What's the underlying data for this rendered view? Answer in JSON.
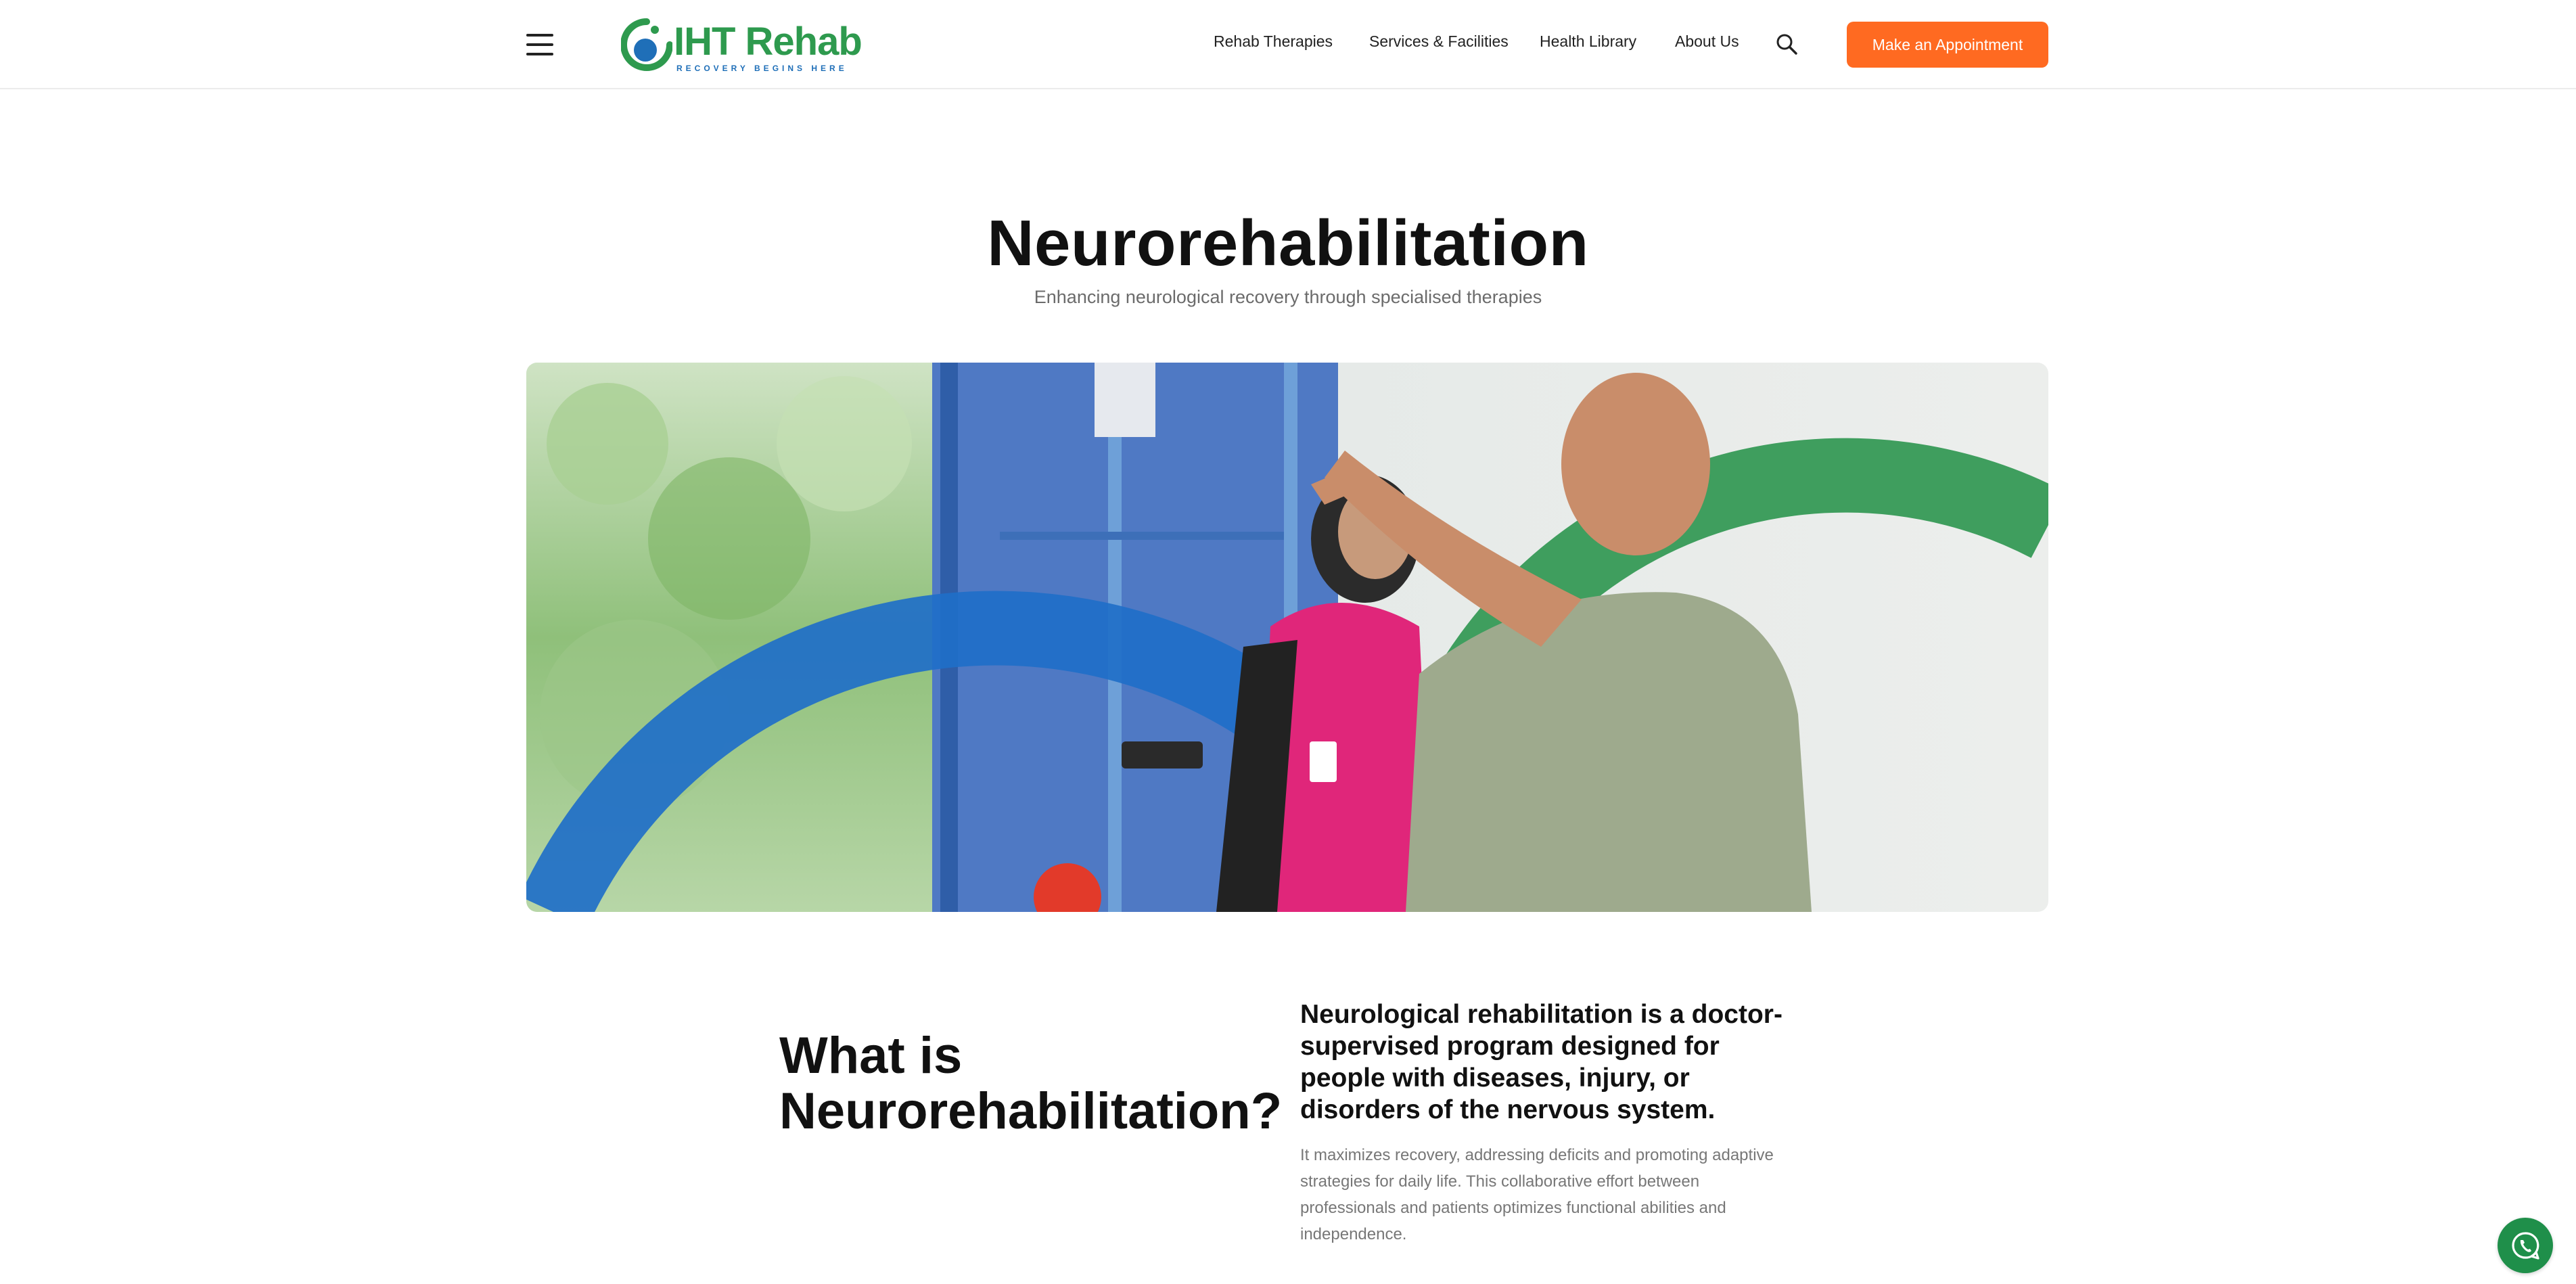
{
  "header": {
    "menu_icon": "hamburger-icon",
    "logo": {
      "name": "IHT Rehab",
      "tagline": "RECOVERY BEGINS HERE"
    },
    "nav": [
      {
        "label": "Rehab Therapies"
      },
      {
        "label": "Services & Facilities"
      },
      {
        "label": "Health Library"
      },
      {
        "label": "About Us"
      }
    ],
    "search_icon": "search-icon",
    "cta_label": "Make an Appointment"
  },
  "hero": {
    "title": "Neurorehabilitation",
    "subtitle": "Enhancing neurological recovery through specialised therapies"
  },
  "section": {
    "title": "What is Neurorehabilitation?",
    "lead": "Neurological rehabilitation is a doctor-supervised program designed for people with diseases, injury, or disorders of the nervous system.",
    "body": "It maximizes recovery, addressing deficits and promoting adaptive strategies for daily life. This collaborative effort between professionals and patients optimizes functional abilities and independence."
  },
  "floating": {
    "whatsapp_icon": "whatsapp-icon"
  },
  "colors": {
    "brand_green": "#2e9a4e",
    "brand_blue": "#1f6fb8",
    "cta_orange": "#ff6a21",
    "whatsapp_green": "#1f8f4a"
  }
}
